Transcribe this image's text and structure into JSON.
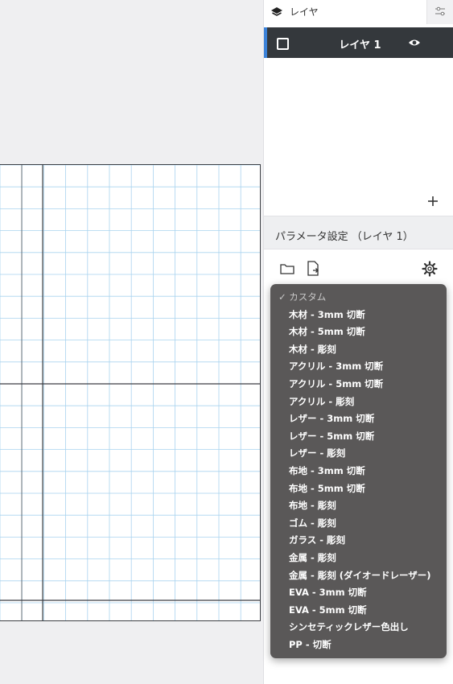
{
  "layers_panel": {
    "title": "レイヤ",
    "layer_name": "レイヤ 1"
  },
  "params_panel": {
    "title": "パラメータ設定 （レイヤ 1）"
  },
  "preset_menu": {
    "selected": "✓ カスタム",
    "items": [
      "木材 - 3mm 切断",
      "木材 - 5mm 切断",
      "木材 - 彫刻",
      "アクリル - 3mm 切断",
      "アクリル - 5mm 切断",
      "アクリル - 彫刻",
      "レザー - 3mm 切断",
      "レザー - 5mm 切断",
      "レザー - 彫刻",
      "布地 - 3mm 切断",
      "布地 - 5mm 切断",
      "布地 - 彫刻",
      "ゴム - 彫刻",
      "ガラス - 彫刻",
      "金属 - 彫刻",
      "金属 - 彫刻 (ダイオードレーザー)",
      "EVA - 3mm 切断",
      "EVA - 5mm 切断",
      "シンセティックレザー色出し",
      "PP - 切断"
    ]
  },
  "icons": {
    "layers": "layers-icon",
    "layer_settings": "sliders-icon",
    "visibility": "eye-icon",
    "add": "plus-icon",
    "folder": "folder-icon",
    "export": "export-icon",
    "settings": "gear-icon"
  },
  "colors": {
    "active_layer_bg": "#34383c",
    "active_layer_accent": "#3b82d9",
    "menu_bg": "#5a5858",
    "grid_minor": "#a9d3ef",
    "grid_major": "#3c3f44"
  }
}
